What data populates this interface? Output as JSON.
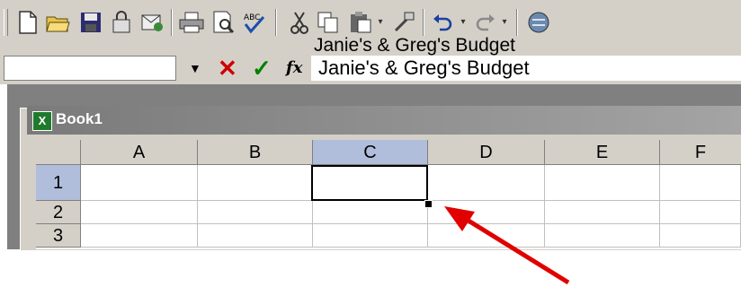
{
  "formula_bar": {
    "name_box": "",
    "content": "Janie's & Greg's Budget"
  },
  "workbook": {
    "title": "Book1"
  },
  "sheet": {
    "columns": [
      "A",
      "B",
      "C",
      "D",
      "E",
      "F"
    ],
    "rows": [
      "1",
      "2",
      "3"
    ],
    "active_column": "C",
    "active_row": "1",
    "cells": {
      "C1": "Janie's & Greg's Budget"
    }
  },
  "colors": {
    "header_highlight": "#b0bedb",
    "cancel": "#cc0000",
    "enter": "#008000",
    "arrow": "#e00000"
  },
  "icons": [
    "new-document-icon",
    "open-folder-icon",
    "save-icon",
    "permission-icon",
    "mail-icon",
    "print-icon",
    "print-preview-icon",
    "spelling-icon",
    "cut-icon",
    "copy-icon",
    "paste-icon",
    "format-painter-icon",
    "undo-icon",
    "redo-icon",
    "hyperlink-icon"
  ]
}
